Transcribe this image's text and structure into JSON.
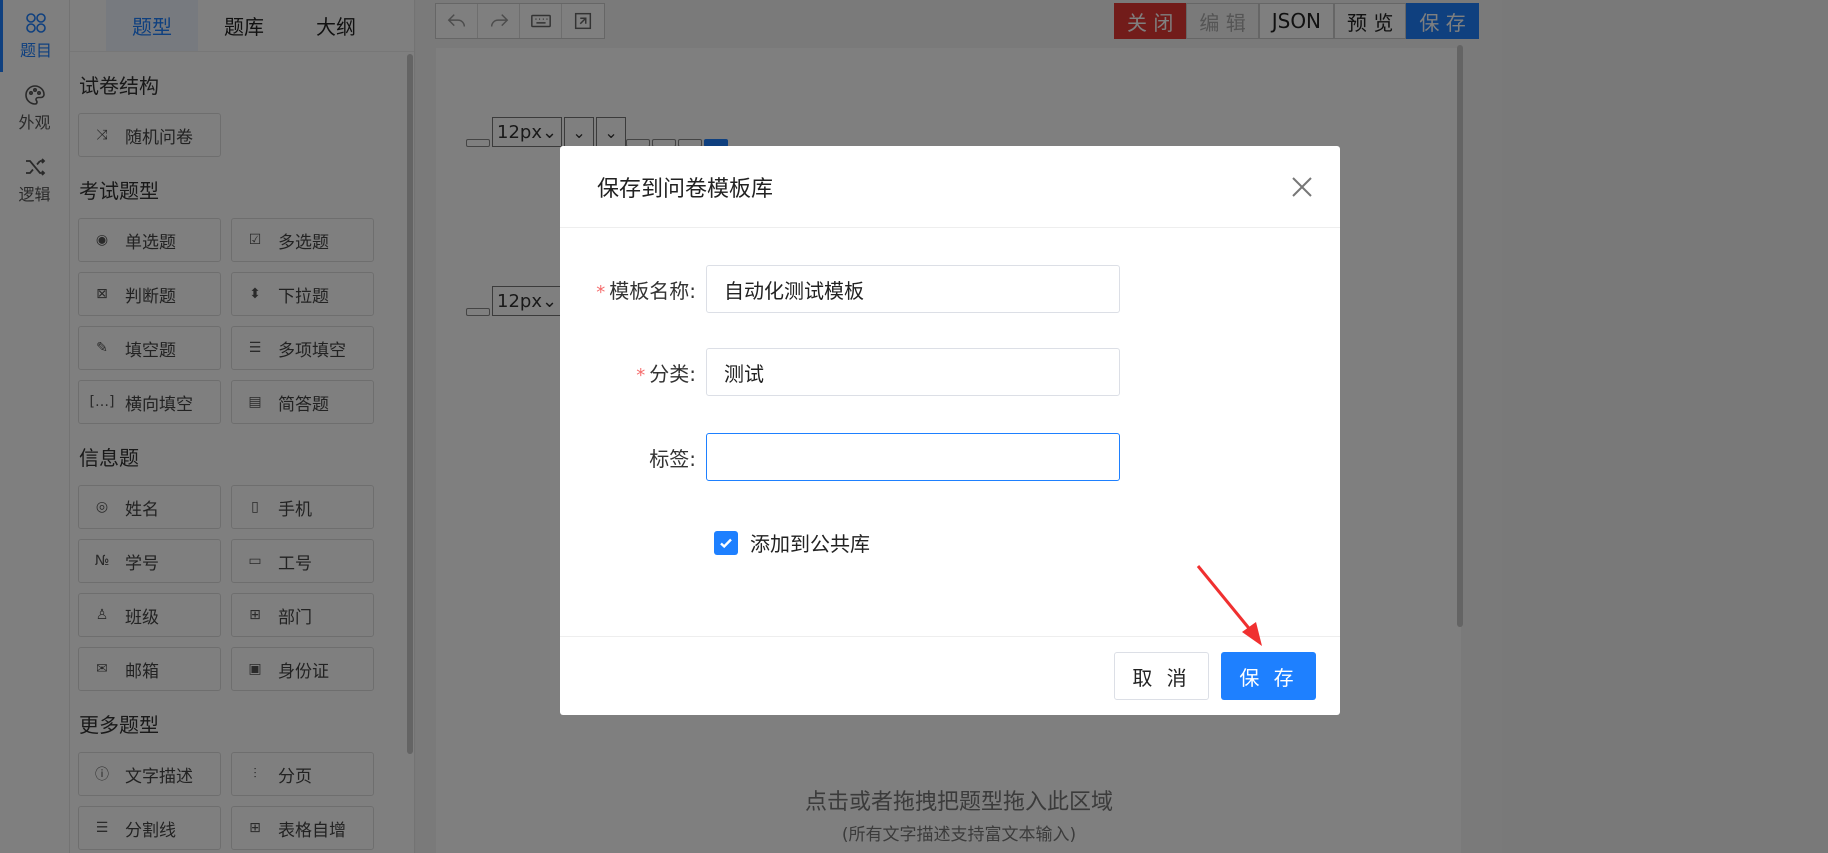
{
  "rail": {
    "items": [
      {
        "label": "题目",
        "icon": "question-type-icon",
        "active": true
      },
      {
        "label": "外观",
        "icon": "palette-icon"
      },
      {
        "label": "逻辑",
        "icon": "shuffle-icon"
      }
    ]
  },
  "panel": {
    "tabs": [
      "题型",
      "题库",
      "大纲"
    ],
    "sections": [
      {
        "title": "试卷结构",
        "items": [
          {
            "label": "随机问卷",
            "icon": "shuffle-icon"
          }
        ]
      },
      {
        "title": "考试题型",
        "items": [
          {
            "label": "单选题",
            "icon": "radio-icon"
          },
          {
            "label": "多选题",
            "icon": "checkbox-icon"
          },
          {
            "label": "判断题",
            "icon": "judge-icon"
          },
          {
            "label": "下拉题",
            "icon": "dropdown-icon"
          },
          {
            "label": "填空题",
            "icon": "edit-icon"
          },
          {
            "label": "多项填空",
            "icon": "multi-fill-icon"
          },
          {
            "label": "横向填空",
            "icon": "horizontal-fill-icon"
          },
          {
            "label": "简答题",
            "icon": "document-icon"
          }
        ]
      },
      {
        "title": "信息题",
        "items": [
          {
            "label": "姓名",
            "icon": "user-icon"
          },
          {
            "label": "手机",
            "icon": "phone-icon"
          },
          {
            "label": "学号",
            "icon": "number-icon"
          },
          {
            "label": "工号",
            "icon": "badge-icon"
          },
          {
            "label": "班级",
            "icon": "class-icon"
          },
          {
            "label": "部门",
            "icon": "org-icon"
          },
          {
            "label": "邮箱",
            "icon": "mail-icon"
          },
          {
            "label": "身份证",
            "icon": "id-card-icon"
          }
        ]
      },
      {
        "title": "更多题型",
        "items": [
          {
            "label": "文字描述",
            "icon": "info-icon"
          },
          {
            "label": "分页",
            "icon": "page-break-icon"
          },
          {
            "label": "分割线",
            "icon": "divider-icon"
          },
          {
            "label": "表格自增",
            "icon": "table-add-icon"
          }
        ]
      }
    ]
  },
  "toolbar": {
    "close": "关 闭",
    "edit": "编 辑",
    "json": "JSON",
    "preview": "预 览",
    "save": "保 存"
  },
  "editor": {
    "font_size_1": "12px",
    "font_size_2": "12px",
    "hint_main": "点击或者拖拽把题型拖入此区域",
    "hint_sub": "(所有文字描述支持富文本输入)"
  },
  "modal": {
    "title": "保存到问卷模板库",
    "fields": {
      "name_label": "模板名称:",
      "name_value": "自动化测试模板",
      "category_label": "分类:",
      "category_value": "测试",
      "tags_label": "标签:",
      "tags_value": ""
    },
    "checkbox_label": "添加到公共库",
    "checkbox_checked": true,
    "cancel": "取 消",
    "save": "保 存"
  },
  "colors": {
    "accent": "#1e80ff",
    "danger": "#e53935",
    "required": "#f56c6c",
    "annotation_arrow": "#f03030"
  }
}
